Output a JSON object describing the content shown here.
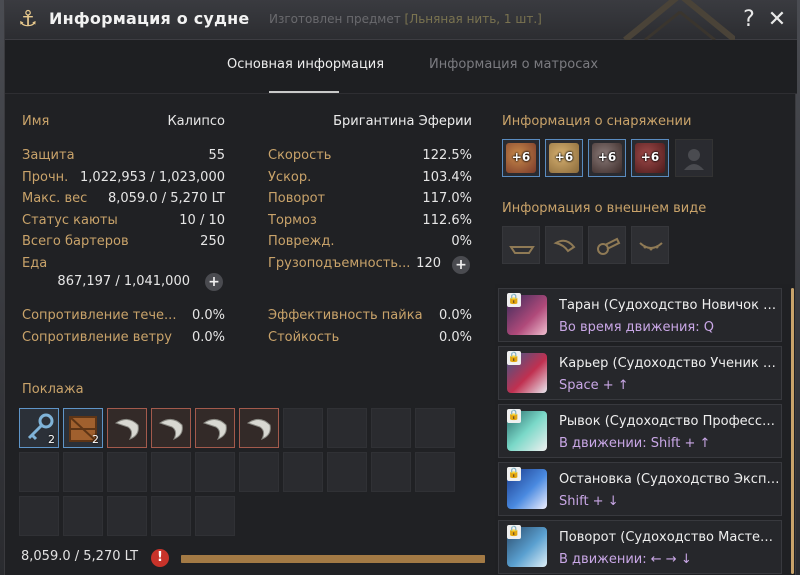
{
  "window": {
    "title": "Информация о судне",
    "notice_prefix": "Изготовлен предмет ",
    "notice_item": "[Льняная нить, 1 шт.]",
    "help_label": "?",
    "close_label": "✕"
  },
  "tabs": [
    {
      "label": "Основная информация",
      "active": true
    },
    {
      "label": "Информация о матросах",
      "active": false
    }
  ],
  "ship": {
    "name_label": "Имя",
    "name_value": "Калипсо",
    "type_value": "Бригантина Эферии"
  },
  "stats_left": [
    {
      "label": "Защита",
      "value": "55"
    },
    {
      "label": "Прочн.",
      "value": "1,022,953 / 1,023,000"
    },
    {
      "label": "Макс. вес",
      "value": "8,059.0 / 5,270 LT"
    },
    {
      "label": "Статус каюты",
      "value": "10 / 10"
    },
    {
      "label": "Всего бартеров",
      "value": "250"
    }
  ],
  "food": {
    "label": "Еда",
    "value": "867,197 / 1,041,000"
  },
  "stats_right": [
    {
      "label": "Скорость",
      "value": "122.5%"
    },
    {
      "label": "Ускор.",
      "value": "103.4%"
    },
    {
      "label": "Поворот",
      "value": "117.0%"
    },
    {
      "label": "Тормоз",
      "value": "112.6%"
    },
    {
      "label": "Поврежд.",
      "value": "0%"
    },
    {
      "label": "Грузоподъемность...",
      "value": "120"
    }
  ],
  "resist_left": [
    {
      "label": "Сопротивление тече...",
      "value": "0.0%"
    },
    {
      "label": "Сопротивление ветру",
      "value": "0.0%"
    }
  ],
  "resist_right": [
    {
      "label": "Эффективность пайка",
      "value": "0.0%"
    },
    {
      "label": "Стойкость",
      "value": "0.0%"
    }
  ],
  "equipment": {
    "title": "Информация о снаряжении",
    "items": [
      {
        "level": "+6",
        "icon": "ship-prow-icon",
        "color": "#7a3a2a"
      },
      {
        "level": "+6",
        "icon": "ship-plating-icon",
        "color": "#8a6a3a"
      },
      {
        "level": "+6",
        "icon": "ship-cannon-icon",
        "color": "#5a4a48"
      },
      {
        "level": "+6",
        "icon": "ship-sail-icon",
        "color": "#6a2a2a"
      }
    ],
    "empty_icon": "sailor-silhouette-icon"
  },
  "appearance": {
    "title": "Информация о внешнем виде",
    "slots": [
      "hull-outline-icon",
      "sail-outline-icon",
      "cannon-outline-icon",
      "flag-outline-icon"
    ]
  },
  "cargo": {
    "title": "Поклажа",
    "items": [
      {
        "icon": "key-icon",
        "count": "2",
        "border": "blue"
      },
      {
        "icon": "crate-icon",
        "count": "2",
        "border": "blue"
      },
      {
        "icon": "shrimp-icon",
        "count": "",
        "border": "red"
      },
      {
        "icon": "shrimp-icon",
        "count": "",
        "border": "red"
      },
      {
        "icon": "shrimp-icon",
        "count": "",
        "border": "red"
      },
      {
        "icon": "shrimp-icon",
        "count": "",
        "border": "red"
      }
    ],
    "weight": "8,059.0 / 5,270 LT",
    "warning_label": "!",
    "weight_fill_fraction": 1.0
  },
  "skills": [
    {
      "name": "Таран (Судоходство Новичок У...",
      "key": "Во время движения: Q",
      "icon": "ram-skill-icon"
    },
    {
      "name": "Карьер (Судоходство Ученик У...",
      "key": "Space + ↑",
      "icon": "gallop-skill-icon"
    },
    {
      "name": "Рывок (Судоходство Професси...",
      "key": "В движении: Shift + ↑",
      "icon": "dash-skill-icon"
    },
    {
      "name": "Остановка (Судоходство Экспе...",
      "key": "Shift + ↓",
      "icon": "stop-skill-icon"
    },
    {
      "name": "Поворот (Судоходство Мастер ...",
      "key": "В движении: ← → ↓",
      "icon": "turn-skill-icon"
    }
  ]
}
